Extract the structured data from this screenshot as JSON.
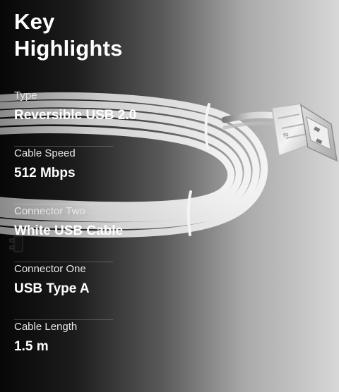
{
  "heading": {
    "line1": "Key",
    "line2": "Highlights"
  },
  "specs": [
    {
      "label": "Type",
      "value": "Reversible USB 2.0"
    },
    {
      "label": "Cable Speed",
      "value": "512 Mbps"
    },
    {
      "label": "Connector Two",
      "value": "White USB Cable"
    },
    {
      "label": "Connector One",
      "value": "USB Type A"
    },
    {
      "label": "Cable Length",
      "value": "1.5 m"
    }
  ],
  "image": {
    "subject": "white-usb-cable-icon"
  },
  "colors": {
    "background_dark": "#070707",
    "background_light": "#d7d7d7",
    "text": "#ffffff",
    "cable": "#e8e8e8"
  }
}
